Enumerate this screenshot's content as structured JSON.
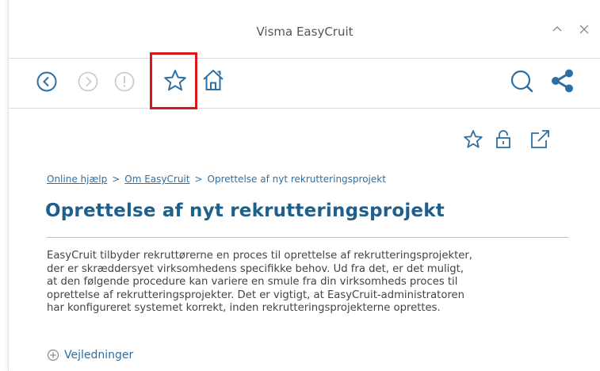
{
  "window": {
    "title": "Visma EasyCruit",
    "minimize_icon": "caret-up-icon",
    "close_icon": "close-icon"
  },
  "toolbar": {
    "back_icon": "back-circle-icon",
    "forward_icon": "forward-circle-icon",
    "alert_icon": "exclamation-circle-icon",
    "favorite_icon": "star-icon",
    "home_icon": "home-icon",
    "search_icon": "search-icon",
    "share_icon": "share-icon",
    "highlighted": "favorite-button"
  },
  "page_actions": {
    "favorite_icon": "star-icon",
    "unlock_icon": "unlock-icon",
    "open_external_icon": "external-link-icon"
  },
  "breadcrumb": {
    "items": [
      "Online hjælp",
      "Om EasyCruit"
    ],
    "separator": ">",
    "current": "Oprettelse af nyt rekrutteringsprojekt"
  },
  "main": {
    "title": "Oprettelse af nyt rekrutteringsprojekt",
    "intro_lines": [
      "EasyCruit tilbyder rekruttørerne en proces til oprettelse af rekrutteringsprojekter,",
      "der er skræddersyet virksomhedens specifikke behov. Ud fra det, er det muligt,",
      "at den følgende procedure kan variere en smule fra din virksomheds proces til",
      "oprettelse af rekrutteringsprojekter. Det er vigtigt, at EasyCruit-administratoren",
      "har konfigureret systemet korrekt, inden rekrutteringsprojekterne oprettes."
    ],
    "expander_label": "Vejledninger",
    "expander_icon": "plus-circle-icon"
  },
  "colors": {
    "accent": "#2d6fa3",
    "title": "#1f5f8b",
    "highlight": "#d6171c",
    "disabled_icon": "#c8c8c8"
  }
}
